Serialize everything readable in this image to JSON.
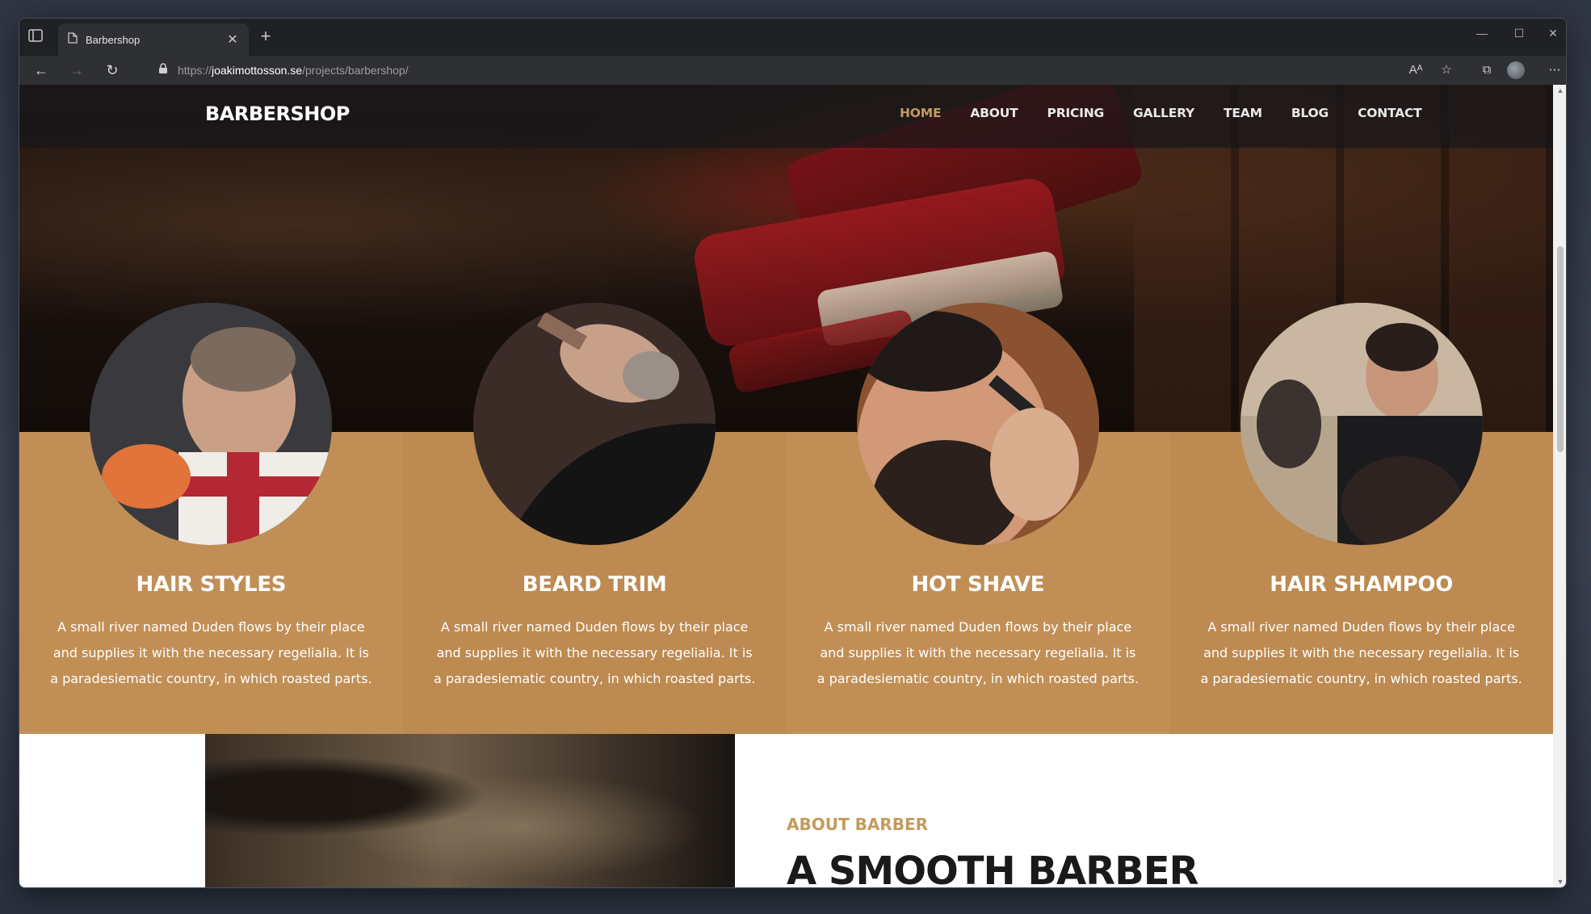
{
  "browser": {
    "tab_title": "Barbershop",
    "url_prefix": "https://",
    "url_host": "joakimottosson.se",
    "url_path": "/projects/barbershop/"
  },
  "site": {
    "brand": "BARBERSHOP",
    "nav": [
      "HOME",
      "ABOUT",
      "PRICING",
      "GALLERY",
      "TEAM",
      "BLOG",
      "CONTACT"
    ],
    "active_nav": "HOME",
    "accent_color": "#c49a5e",
    "services_bg": "#c18f56"
  },
  "services": [
    {
      "title": "HAIR STYLES",
      "text": "A small river named Duden flows by their place and supplies it with the necessary regelialia. It is a paradesiematic country, in which roasted parts."
    },
    {
      "title": "BEARD TRIM",
      "text": "A small river named Duden flows by their place and supplies it with the necessary regelialia. It is a paradesiematic country, in which roasted parts."
    },
    {
      "title": "HOT SHAVE",
      "text": "A small river named Duden flows by their place and supplies it with the necessary regelialia. It is a paradesiematic country, in which roasted parts."
    },
    {
      "title": "HAIR SHAMPOO",
      "text": "A small river named Duden flows by their place and supplies it with the necessary regelialia. It is a paradesiematic country, in which roasted parts."
    }
  ],
  "about": {
    "eyebrow": "ABOUT BARBER",
    "title": "A SMOOTH BARBER"
  }
}
